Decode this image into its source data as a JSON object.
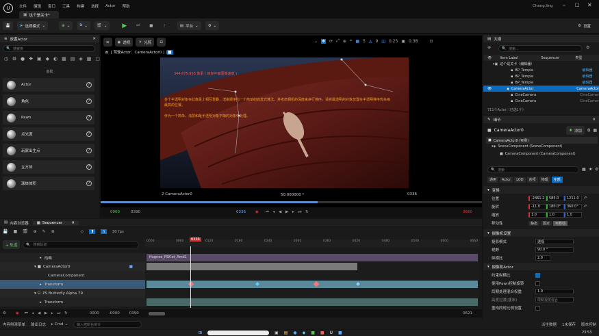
{
  "app": {
    "title": "这个是关卡*",
    "user": "Cheng.ling"
  },
  "menu": [
    "文件",
    "编辑",
    "窗口",
    "工具",
    "构建",
    "选择",
    "Actor",
    "帮助"
  ],
  "toolbar": {
    "save_label": "保存",
    "mode_label": "选择模式",
    "platform_label": "平台",
    "settings_label": "设置"
  },
  "place_actors": {
    "title": "放置Actor",
    "search_placeholder": "搜索类",
    "category": "基础",
    "items": [
      "Actor",
      "角色",
      "Pawn",
      "点光源",
      "玩家出生点",
      "立方体",
      "球体体积"
    ]
  },
  "viewport": {
    "perspective": "透视",
    "lit": "光照",
    "pilot_label": "[ 驾驶Actor：CameraActor0 ]",
    "camera_name": "2 CameraActor0",
    "focal": "50.000000 *",
    "frame": "0336",
    "fov_label": "0.25",
    "speed": "0.38",
    "grid": "5",
    "rot": "9",
    "overlay_title": "344.875.958 像素 ( 目标平面图像速度 )",
    "overlay_text": "多个半透明对象在此像素上相互重叠，渲染顺序为一个简单的启发式算法，并考虑相机的深度来进行排序，请将最透明的对象放置在半透明排序优先级最高的位置。",
    "overlay_text2": "作为一个简单，浅层和最半透明对象平衡的对象中处理。",
    "time_left": "0000",
    "time_right": "0390",
    "time_mid": "0336",
    "time_end": "0660"
  },
  "outliner": {
    "title": "大纲",
    "search_placeholder": "搜索...",
    "col_label": "Item Label",
    "col_seq": "Sequencer",
    "col_type": "类型",
    "root": "这个是关卡（编辑器）",
    "rows": [
      {
        "name": "BP_Temple",
        "type": "编辑器"
      },
      {
        "name": "BP_Temple",
        "type": "编辑器"
      },
      {
        "name": "BP_Temple",
        "type": "编辑器"
      },
      {
        "name": "CameraActor",
        "type": "CameraActor"
      },
      {
        "name": "CineCamera",
        "type": "CineCamer"
      },
      {
        "name": "CineCamera",
        "type": "CineCamer"
      }
    ],
    "footer": "711个Actor（已选1个）"
  },
  "details": {
    "title": "细节",
    "actor": "CameraActor0",
    "add_label": "添加",
    "instance": "CameraActor0 (实例)",
    "components": [
      "SceneComponent (SceneComponent)",
      "CameraComponent (CameraComponent)"
    ],
    "search_placeholder": "搜索",
    "filters": [
      "通用",
      "Actor",
      "LOD",
      "杂项",
      "物理",
      "渲染",
      "流送",
      "全部"
    ],
    "transform_label": "变换",
    "location": "位置",
    "rotation": "旋转",
    "scale": "缩放",
    "mobility": "移动性",
    "mobility_options": [
      "静态",
      "固定",
      "可移动"
    ],
    "loc": [
      "-2461.2",
      "585.0",
      "1211.0"
    ],
    "rot": [
      "-11.0",
      "180.0°",
      "360.0°"
    ],
    "scl": [
      "1.0",
      "1.0",
      "1.0"
    ],
    "cam_opts": "摄像机设置",
    "cam_rows": [
      {
        "label": "投影模式",
        "value": "透视"
      },
      {
        "label": "视野",
        "value": "90.0 °"
      },
      {
        "label": "纵横比",
        "value": "2.0"
      }
    ],
    "cam_actor": "摄像机Actor",
    "cam_actor_rows": [
      {
        "label": "约束纵横比",
        "value": ""
      },
      {
        "label": "使用Pawn控制旋转",
        "value": ""
      },
      {
        "label": "后期处理混合权重",
        "value": "1.0"
      },
      {
        "label": "高度过渡(厘米)",
        "value": "限制视觉混合"
      },
      {
        "label": "重构同时比例设置",
        "value": ""
      }
    ]
  },
  "content_drawer": {
    "tab": "内容浏览器",
    "sequencer_tab": "Sequencer"
  },
  "sequencer": {
    "fps": "30 fps",
    "playhead": "0336",
    "search_placeholder": "搜索轨道",
    "add": "+ 轨道",
    "tracks": [
      {
        "name": "动画",
        "indent": 0
      },
      {
        "name": "CameraActor0",
        "indent": 1
      },
      {
        "name": "CameraComponent",
        "indent": 2
      },
      {
        "name": "Transform",
        "indent": 2
      },
      {
        "name": "PS Butterfly Alpha 79",
        "indent": 1
      },
      {
        "name": "Transform",
        "indent": 2
      }
    ],
    "clip_label": "Hugnee_PSK-et_Amd1",
    "ruler": [
      "0000",
      "0060",
      "0120",
      "0180",
      "0240",
      "0300",
      "0360",
      "0420",
      "0480",
      "0540",
      "0600",
      "0660"
    ],
    "bottom": [
      "0000",
      "-0000",
      "0396",
      "0390",
      "0621"
    ]
  },
  "status": {
    "content": "内容侧滑菜单",
    "output": "输出日志",
    "cmd": "Cmd",
    "cmd_placeholder": "输入控制台命令",
    "derived": "派生数据",
    "unsaved": "1未保存",
    "source": "版本控制",
    "time": "23:53"
  }
}
